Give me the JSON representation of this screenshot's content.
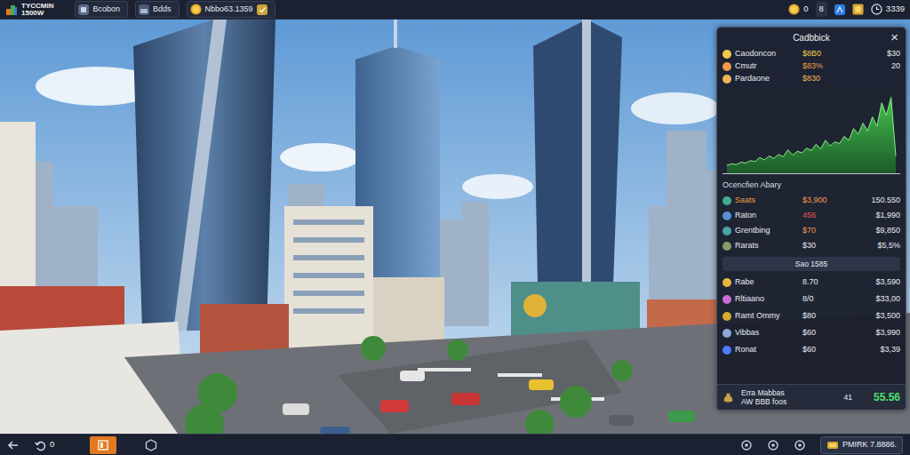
{
  "top_bar": {
    "logo": {
      "line1": "TYCCMIN",
      "line2": "1500W"
    },
    "tabs": [
      {
        "label": "Bcobon",
        "selected": false
      },
      {
        "label": "Bdds",
        "selected": false
      },
      {
        "label": "Nbbo63.1359",
        "selected": false
      }
    ],
    "resources": [
      {
        "kind": "coin",
        "value": "0"
      },
      {
        "kind": "box",
        "value": "8"
      },
      {
        "kind": "clock",
        "value": "3339"
      }
    ]
  },
  "panel": {
    "title": "Cadbbick",
    "close": "×",
    "summary": [
      {
        "label": "Caodoncon",
        "value": "$8B0",
        "extra": "$30",
        "color": "#f2c94c"
      },
      {
        "label": "Cmutr",
        "value": "$83%",
        "extra": "20",
        "color": "#f2994a"
      },
      {
        "label": "Pardaone",
        "value": "$830",
        "color": "#f2b35a"
      }
    ],
    "chart": {
      "values": [
        8,
        10,
        9,
        12,
        11,
        14,
        13,
        18,
        15,
        20,
        17,
        22,
        19,
        28,
        21,
        26,
        24,
        30,
        27,
        35,
        29,
        40,
        33,
        38,
        36,
        45,
        40,
        55,
        48,
        62,
        52,
        70,
        58,
        88,
        72,
        95,
        20
      ]
    },
    "section_title": "Ocencfien Abary",
    "overview": [
      {
        "label": "Saats",
        "value": "$3,900",
        "total": "150.550",
        "color": "#f2994a"
      },
      {
        "label": "Raton",
        "value": "456",
        "total": "$1,990",
        "color": "#eb5757"
      },
      {
        "label": "Grentbing",
        "value": "$70",
        "total": "$9,850",
        "color": "#f2994a"
      },
      {
        "label": "Rarats",
        "value": "$30",
        "total": "$5,5%",
        "color": "#e6e6e6"
      }
    ],
    "divider": "Sao 1585",
    "assets": [
      {
        "label": "Rabe",
        "value": "8.70",
        "total": "$3,590",
        "color": "#e9b73b"
      },
      {
        "label": "Rltiaano",
        "value": "8/0",
        "total": "$33,00",
        "color": "#c86dd7"
      },
      {
        "label": "Ramt Ommy",
        "value": "$80",
        "total": "$3,500",
        "color": "#d8a933"
      },
      {
        "label": "Vibbas",
        "value": "$60",
        "total": "$3,990",
        "color": "#8aa9d8"
      },
      {
        "label": "Ronat",
        "value": "$60",
        "total": "$3,39",
        "color": "#4d7cff"
      }
    ],
    "footer": {
      "line1": "Erra Mabbas",
      "line2": "AW BBB foos",
      "count": "41",
      "total": "55.56"
    }
  },
  "bottom_bar": {
    "undo_count": "0",
    "badge": "PMIRK 7.8886."
  }
}
